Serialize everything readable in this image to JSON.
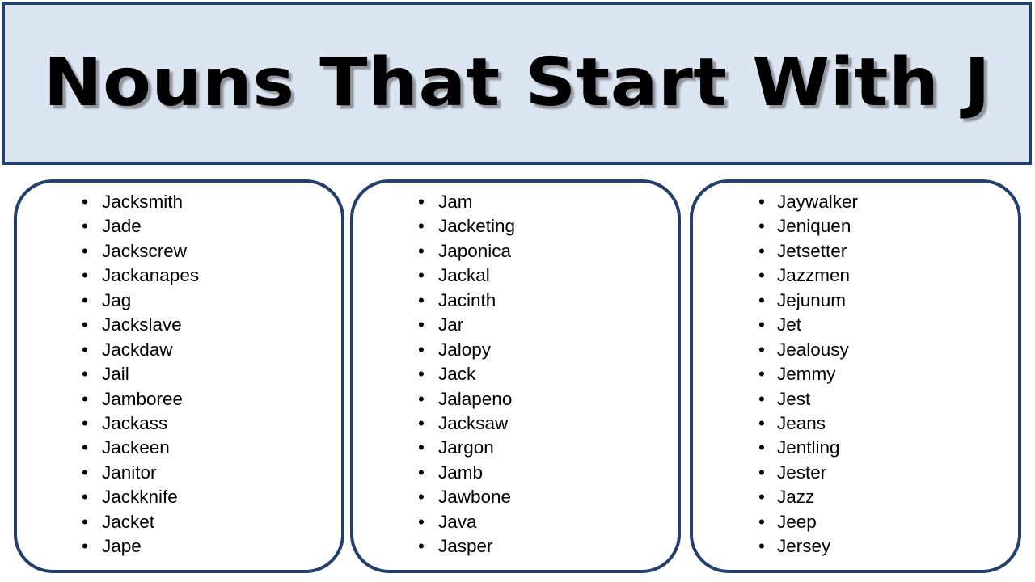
{
  "title": "Nouns That Start With J",
  "bullet_glyph": "•",
  "colors": {
    "banner_background": "#dce6f3",
    "border_navy": "#22406b",
    "card_background": "#ffffff",
    "text": "#000000",
    "page_background": "#ffffff"
  },
  "columns": [
    {
      "name": "column-1",
      "items": [
        "Jacksmith",
        "Jade",
        "Jackscrew",
        "Jackanapes",
        "Jag",
        "Jackslave",
        "Jackdaw",
        "Jail",
        "Jamboree",
        "Jackass",
        "Jackeen",
        "Janitor",
        "Jackknife",
        "Jacket",
        "Jape"
      ]
    },
    {
      "name": "column-2",
      "items": [
        "Jam",
        "Jacketing",
        "Japonica",
        "Jackal",
        "Jacinth",
        "Jar",
        "Jalopy",
        "Jack",
        "Jalapeno",
        "Jacksaw",
        "Jargon",
        "Jamb",
        "Jawbone",
        "Java",
        "Jasper"
      ]
    },
    {
      "name": "column-3",
      "items": [
        "Jaywalker",
        "Jeniquen",
        "Jetsetter",
        "Jazzmen",
        "Jejunum",
        "Jet",
        "Jealousy",
        "Jemmy",
        "Jest",
        "Jeans",
        "Jentling",
        "Jester",
        "Jazz",
        "Jeep",
        "Jersey"
      ]
    }
  ]
}
